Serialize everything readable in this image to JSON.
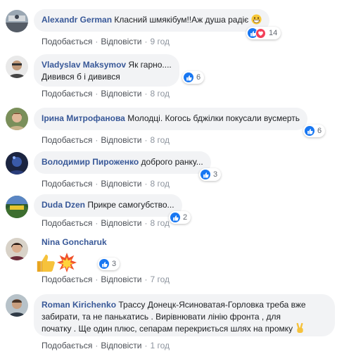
{
  "actions": {
    "like_label": "Подобається",
    "reply_label": "Відповісти",
    "separator": "·"
  },
  "comments": [
    {
      "author": "Alexandr German",
      "text": "Класний шмякібум!!Аж душа радіє",
      "emoji": "grin-face-emoji",
      "reactions": [
        "like",
        "love"
      ],
      "reaction_count": "14",
      "time": "9 год"
    },
    {
      "author": "Vladyslav Maksymov",
      "text_line1": "Як гарно....",
      "text_line2": "Дивився б і дивився",
      "reactions": [
        "like"
      ],
      "reaction_count": "6",
      "time": "8 год"
    },
    {
      "author": "Ірина Митрофанова",
      "text": "Молодці. Когось бджілки покусали вусмерть",
      "reactions": [
        "like"
      ],
      "reaction_count": "6",
      "time": "8 год"
    },
    {
      "author": "Володимир Пироженко",
      "text": "доброго ранку...",
      "reactions": [
        "like"
      ],
      "reaction_count": "3",
      "time": "8 год"
    },
    {
      "author": "Duda Dzen",
      "text": "Прикре самогубство...",
      "reactions": [
        "like"
      ],
      "reaction_count": "2",
      "time": "8 год"
    },
    {
      "author": "Nina Goncharuk",
      "emoji": [
        "thumbs-up-emoji",
        "collision-emoji"
      ],
      "reactions": [
        "like"
      ],
      "reaction_count": "3",
      "time": "7 год"
    },
    {
      "author": "Roman Kirichenko",
      "text_line1": "Трассу Донецк-Ясиноватая-Горловка треба вже",
      "text_line2": "забирати, та не панькатись . Вирівнювати лінію фронта , для",
      "text_line3": "початку . Ще один плюс, сепарам перекриється шлях на промку",
      "emoji": "victory-hand-emoji",
      "time": "1 год"
    }
  ],
  "colors": {
    "author": "#385898",
    "bubble": "#f2f3f5",
    "like_blue": "#1877f2",
    "love_red": "#f33e58",
    "meta_gray": "#8d949e"
  }
}
